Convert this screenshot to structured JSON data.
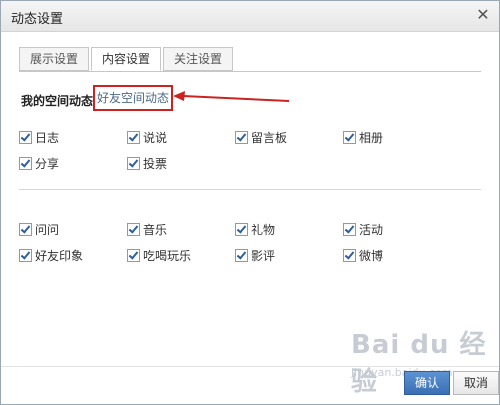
{
  "dialog": {
    "title": "动态设置",
    "close_symbol": "✕"
  },
  "tabs": [
    {
      "label": "展示设置",
      "active": false
    },
    {
      "label": "内容设置",
      "active": true
    },
    {
      "label": "关注设置",
      "active": false
    }
  ],
  "section": {
    "title": "我的空间动态",
    "friend_link": "好友空间动态"
  },
  "group1": [
    [
      {
        "label": "日志",
        "checked": true
      },
      {
        "label": "说说",
        "checked": true
      },
      {
        "label": "留言板",
        "checked": true
      },
      {
        "label": "相册",
        "checked": true
      }
    ],
    [
      {
        "label": "分享",
        "checked": true
      },
      {
        "label": "投票",
        "checked": true
      }
    ]
  ],
  "group2": [
    [
      {
        "label": "问问",
        "checked": true
      },
      {
        "label": "音乐",
        "checked": true
      },
      {
        "label": "礼物",
        "checked": true
      },
      {
        "label": "活动",
        "checked": true
      }
    ],
    [
      {
        "label": "好友印象",
        "checked": true
      },
      {
        "label": "吃喝玩乐",
        "checked": true
      },
      {
        "label": "影评",
        "checked": true
      },
      {
        "label": "微博",
        "checked": true
      }
    ]
  ],
  "buttons": {
    "ok": "确认",
    "cancel": "取消"
  },
  "watermark": {
    "main": "Bai du 经验",
    "sub": "jingyan.baidu.com"
  },
  "colors": {
    "highlight": "#cc2222",
    "link": "#4d6a8c",
    "primary": "#3a6fb3"
  }
}
